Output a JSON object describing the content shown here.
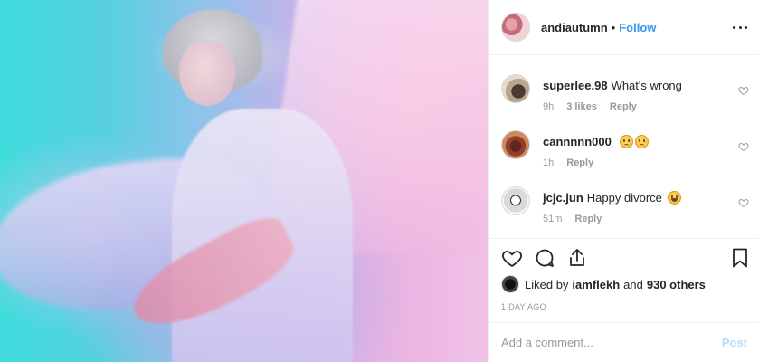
{
  "post": {
    "image_alt": "",
    "author": {
      "username": "andiautumn",
      "separator": "•",
      "follow_label": "Follow"
    }
  },
  "comments": [
    {
      "username": "superlee.98",
      "text": "What's wrong",
      "time": "9h",
      "likes": "3 likes",
      "reply_label": "Reply"
    },
    {
      "username": "cannnnn000",
      "text": "",
      "emoji": [
        "sad",
        "sad"
      ],
      "time": "1h",
      "reply_label": "Reply"
    },
    {
      "username": "jcjc.jun",
      "text": "Happy divorce",
      "emoji": [
        "laugh"
      ],
      "time": "51m",
      "reply_label": "Reply"
    }
  ],
  "icons": {
    "like": "heart-icon",
    "comment": "comment-icon",
    "share": "share-icon",
    "save": "bookmark-icon",
    "more": "more-icon"
  },
  "likes": {
    "prefix": "Liked by",
    "user": "iamflekh",
    "and": "and",
    "others": "930 others"
  },
  "date": "1 DAY AGO",
  "add_comment": {
    "placeholder": "Add a comment...",
    "post_label": "Post"
  },
  "colors": {
    "link": "#3897f0",
    "post_disabled": "#b2dffc",
    "meta": "#999999"
  }
}
